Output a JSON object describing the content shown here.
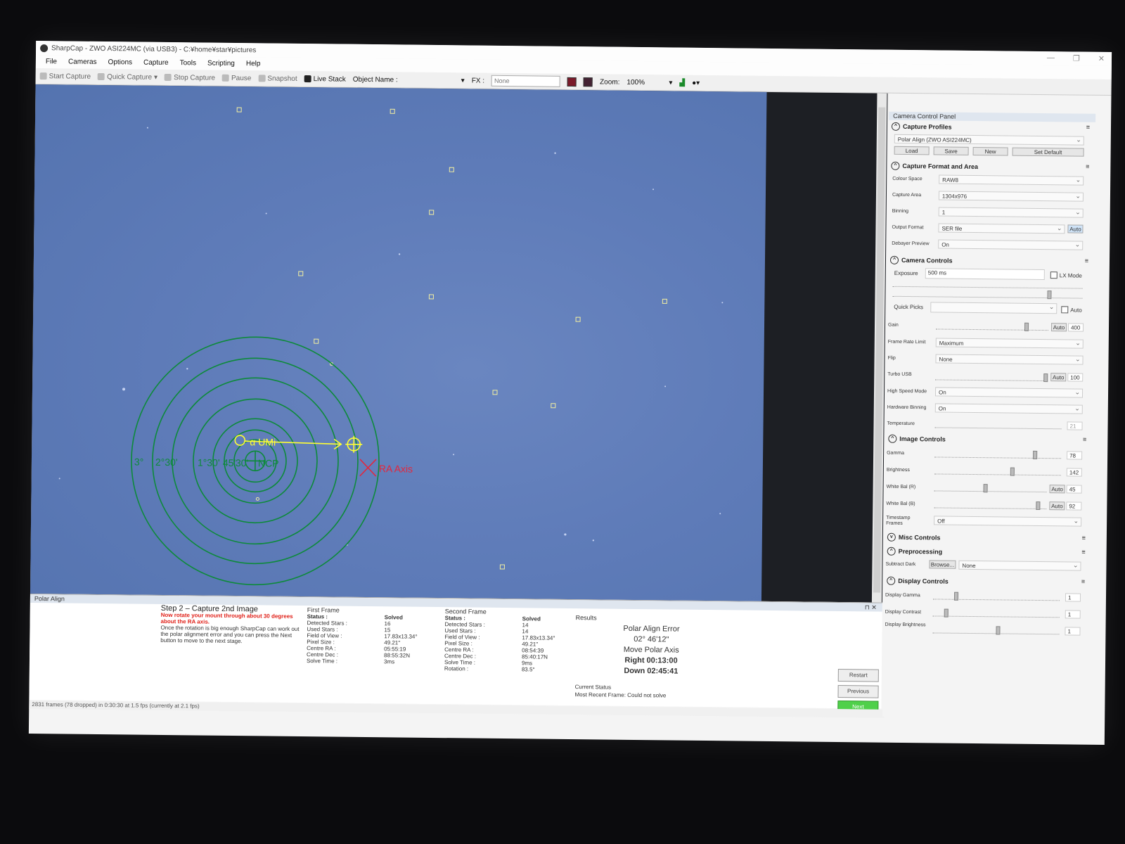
{
  "window": {
    "title": "SharpCap - ZWO ASI224MC (via USB3) - C:¥home¥star¥pictures",
    "controls": [
      "—",
      "❐",
      "✕"
    ]
  },
  "menu": [
    "File",
    "Cameras",
    "Options",
    "Capture",
    "Tools",
    "Scripting",
    "Help"
  ],
  "toolbar": {
    "start_capture": "Start Capture",
    "quick_capture": "Quick Capture",
    "stop_capture": "Stop Capture",
    "pause": "Pause",
    "snapshot": "Snapshot",
    "live_stack": "Live Stack",
    "object_name_label": "Object Name :",
    "fx_label": "FX :",
    "fx_value": "None",
    "zoom_label": "Zoom:",
    "zoom_value": "100%"
  },
  "overlay": {
    "star_label": "α UMi",
    "ra_axis_label": "RA Axis",
    "ring_labels": [
      "3°",
      "2°30'",
      "1°30'",
      "45'",
      "30'",
      "NCP"
    ],
    "colors": {
      "rings": "#0d8a3a",
      "arrow": "#ffff33",
      "ra_axis": "#e4263c",
      "stars_marker": "#f4f0a0"
    }
  },
  "polar_align": {
    "panel_title": "Polar Align",
    "step_title": "Step 2 – Capture 2nd Image",
    "step_warning": "Now rotate your mount through about 30 degrees about the RA axis.",
    "step_text": "Once the rotation is big enough SharpCap can work out the polar alignment error and you can press the Next button to move to the next stage.",
    "first_frame": {
      "header": "First Frame",
      "rows": [
        {
          "k": "Status :",
          "v": "Solved"
        },
        {
          "k": "Detected Stars :",
          "v": "16"
        },
        {
          "k": "Used Stars :",
          "v": "15"
        },
        {
          "k": "Field of View :",
          "v": "17.83x13.34°"
        },
        {
          "k": "Pixel Size :",
          "v": "49.21\""
        },
        {
          "k": "Centre RA :",
          "v": "05:55:19"
        },
        {
          "k": "Centre Dec :",
          "v": "88:55:32N"
        },
        {
          "k": "Solve Time :",
          "v": "3ms"
        }
      ]
    },
    "second_frame": {
      "header": "Second Frame",
      "rows": [
        {
          "k": "Status :",
          "v": "Solved"
        },
        {
          "k": "Detected Stars :",
          "v": "14"
        },
        {
          "k": "Used Stars :",
          "v": "14"
        },
        {
          "k": "Field of View :",
          "v": "17.83x13.34°"
        },
        {
          "k": "Pixel Size :",
          "v": "49.21\""
        },
        {
          "k": "Centre RA :",
          "v": "08:54:39"
        },
        {
          "k": "Centre Dec :",
          "v": "85:40:17N"
        },
        {
          "k": "Solve Time :",
          "v": "9ms"
        },
        {
          "k": "Rotation :",
          "v": "83.5°"
        }
      ]
    },
    "results": {
      "header": "Results",
      "error_label": "Polar Align Error",
      "error_value": "02° 46'12\"",
      "move_label": "Move Polar Axis",
      "right": "Right 00:13:00",
      "down": "Down 02:45:41"
    },
    "current_status_label": "Current Status",
    "current_status_value": "Most Recent Frame: Could not solve",
    "buttons": {
      "restart": "Restart",
      "previous": "Previous",
      "next": "Next"
    }
  },
  "status_bar": "2831 frames (78 dropped) in 0:30:30 at 1.5 fps  (currently at 2.1 fps)",
  "ccp": {
    "title": "Camera Control Panel",
    "capture_profiles": {
      "header": "Capture Profiles",
      "profile": "Polar Align (ZWO ASI224MC)",
      "buttons": [
        "Load",
        "Save",
        "New",
        "Set Default"
      ]
    },
    "capture_format": {
      "header": "Capture Format and Area",
      "rows": [
        {
          "label": "Colour Space",
          "value": "RAW8"
        },
        {
          "label": "Capture Area",
          "value": "1304x976"
        },
        {
          "label": "Binning",
          "value": "1"
        },
        {
          "label": "Output Format",
          "value": "SER file"
        },
        {
          "label": "Debayer Preview",
          "value": "On"
        }
      ],
      "auto_label": "Auto"
    },
    "camera_controls": {
      "header": "Camera Controls",
      "exposure_label": "Exposure",
      "exposure_value": "500 ms",
      "lx_mode": "LX Mode",
      "quick_picks": "Quick Picks",
      "auto": "Auto",
      "gain_label": "Gain",
      "gain_value": "400",
      "gain_level": 0.82,
      "frame_rate_label": "Frame Rate Limit",
      "frame_rate_value": "Maximum",
      "flip_label": "Flip",
      "flip_value": "None",
      "turbo_label": "Turbo USB",
      "turbo_value": "100",
      "turbo_level": 1.0,
      "high_speed_label": "High Speed Mode",
      "high_speed_value": "On",
      "hw_binning_label": "Hardware Binning",
      "hw_binning_value": "On",
      "temperature_label": "Temperature",
      "temperature_value": "21"
    },
    "image_controls": {
      "header": "Image Controls",
      "gamma_label": "Gamma",
      "gamma_value": "78",
      "brightness_label": "Brightness",
      "brightness_value": "142",
      "wb_r_label": "White Bal (R)",
      "wb_r_value": "45",
      "wb_b_label": "White Bal (B)",
      "wb_b_value": "92",
      "timestamp_label": "Timestamp Frames",
      "timestamp_value": "Off"
    },
    "misc_controls": {
      "header": "Misc Controls"
    },
    "preprocessing": {
      "header": "Preprocessing",
      "subtract_dark_label": "Subtract Dark",
      "browse": "Browse...",
      "value": "None"
    },
    "display_controls": {
      "header": "Display Controls",
      "gamma_label": "Display Gamma",
      "gamma_value": "1",
      "contrast_label": "Display Contrast",
      "contrast_value": "1",
      "brightness_label": "Display Brightness",
      "brightness_value": "1"
    }
  }
}
